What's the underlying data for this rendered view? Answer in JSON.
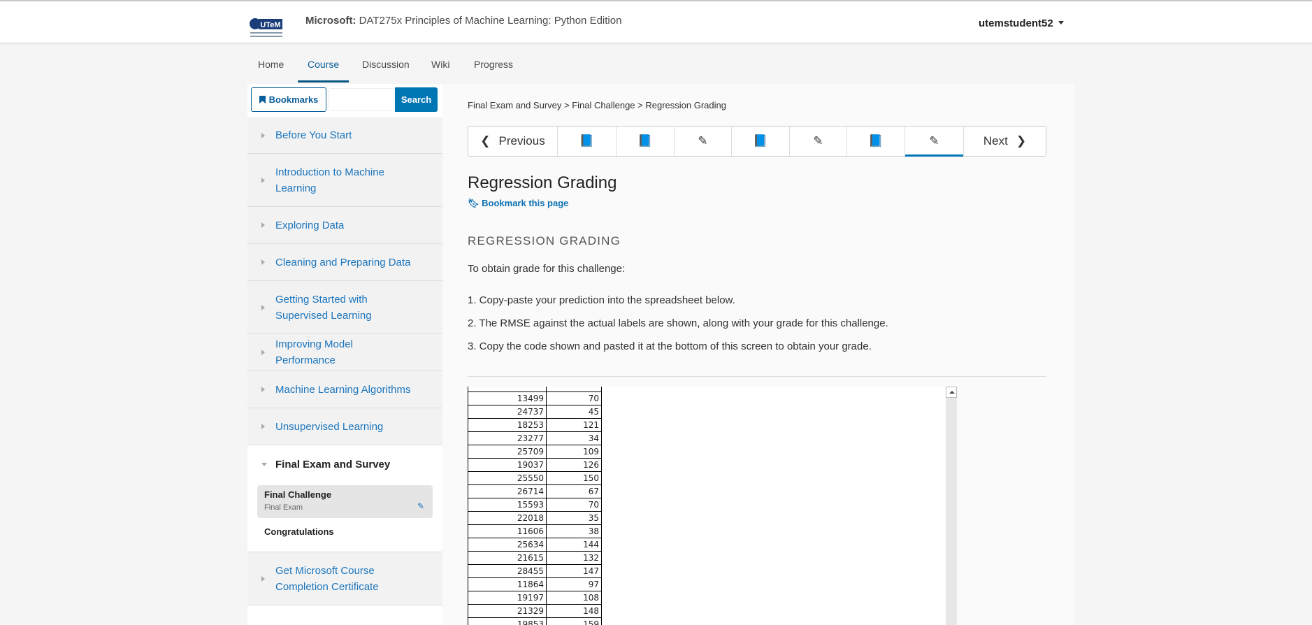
{
  "header": {
    "logo_text": "UTeM",
    "title_org": "Microsoft:",
    "title_course": "DAT275x Principles of Machine Learning: Python Edition",
    "username": "utemstudent52"
  },
  "tabs": [
    {
      "label": "Home"
    },
    {
      "label": "Course",
      "active": true
    },
    {
      "label": "Discussion"
    },
    {
      "label": "Wiki"
    },
    {
      "label": "Progress"
    }
  ],
  "sidebar": {
    "bookmarks_label": "Bookmarks",
    "search_placeholder": "",
    "search_label": "Search",
    "sections": [
      {
        "label": "Before You Start"
      },
      {
        "label": "Introduction to Machine Learning"
      },
      {
        "label": "Exploring Data"
      },
      {
        "label": "Cleaning and Preparing Data"
      },
      {
        "label": "Getting Started with Supervised Learning"
      },
      {
        "label": "Improving Model Performance"
      },
      {
        "label": "Machine Learning Algorithms"
      },
      {
        "label": "Unsupervised Learning"
      },
      {
        "label": "Final Exam and Survey",
        "expanded": true
      },
      {
        "label": "Get Microsoft Course Completion Certificate"
      }
    ],
    "subsections": [
      {
        "title": "Final Challenge",
        "meta": "Final Exam",
        "active": true,
        "icon": "edit-icon"
      },
      {
        "title": "Congratulations"
      }
    ]
  },
  "main": {
    "breadcrumb": "Final Exam and Survey > Final Challenge > Regression Grading",
    "nav": {
      "previous": "Previous",
      "next": "Next",
      "units": [
        "book",
        "book",
        "edit",
        "book",
        "edit",
        "book",
        "edit"
      ],
      "active_index": 6
    },
    "title": "Regression Grading",
    "bookmark_link": "Bookmark this page",
    "section_heading": "REGRESSION GRADING",
    "intro": "To obtain grade for this challenge:",
    "steps": [
      "1. Copy-paste your prediction into the spreadsheet below.",
      "2. The RMSE against the actual labels are shown, along with your grade for this challenge.",
      "3. Copy the code shown and pasted it at the bottom of this screen to obtain your grade."
    ],
    "spreadsheet": [
      [
        "",
        ""
      ],
      [
        "13499",
        "70"
      ],
      [
        "24737",
        "45"
      ],
      [
        "18253",
        "121"
      ],
      [
        "23277",
        "34"
      ],
      [
        "25709",
        "109"
      ],
      [
        "19037",
        "126"
      ],
      [
        "25550",
        "150"
      ],
      [
        "26714",
        "67"
      ],
      [
        "15593",
        "70"
      ],
      [
        "22018",
        "35"
      ],
      [
        "11606",
        "38"
      ],
      [
        "25634",
        "144"
      ],
      [
        "21615",
        "132"
      ],
      [
        "28455",
        "147"
      ],
      [
        "11864",
        "97"
      ],
      [
        "19197",
        "108"
      ],
      [
        "21329",
        "148"
      ],
      [
        "19853",
        "159"
      ]
    ]
  },
  "colors": {
    "accent": "#0075b4",
    "link": "#1c75bc"
  }
}
